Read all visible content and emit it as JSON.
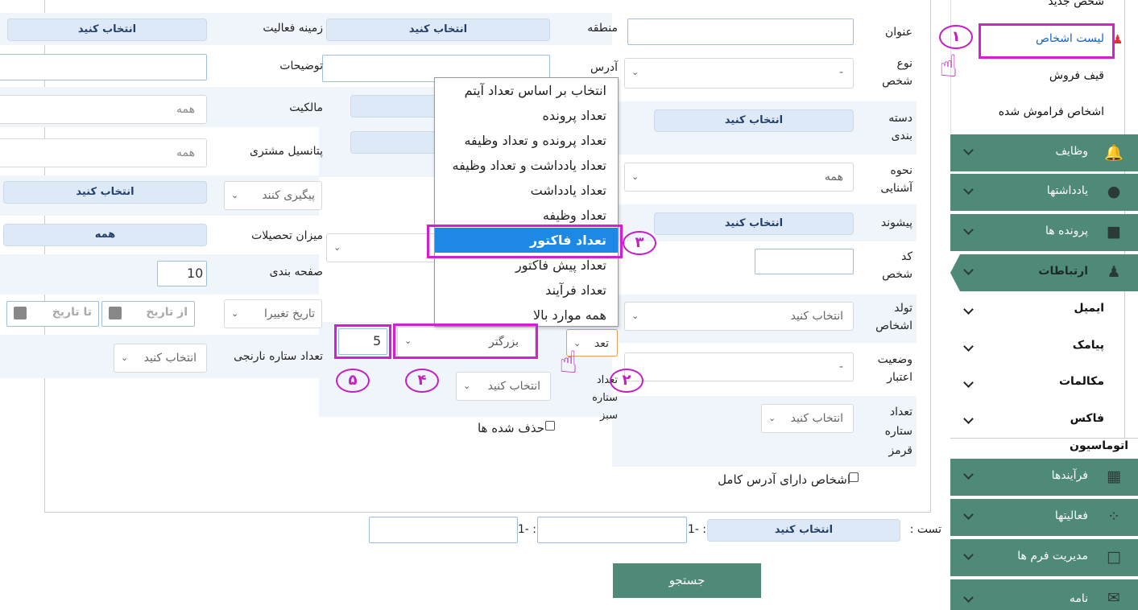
{
  "form": {
    "title_label": "عنوان",
    "person_type_label": "نوع شخص",
    "person_type_value": "-",
    "category_label": "دسته بندی",
    "category_value": "انتخاب کنید",
    "acquaintance_label": "نحوه آشنایی",
    "acquaintance_value": "همه",
    "prefix_label": "پیشوند",
    "prefix_value": "انتخاب کنید",
    "person_code_label": "کد شخص",
    "birth_label": "تولد اشخاص",
    "birth_value": "انتخاب کنید",
    "credit_status_label": "وضعیت اعتبار",
    "credit_status_value": "-",
    "red_stars_label": "تعداد ستاره قرمز",
    "red_stars_value": "انتخاب کنید",
    "full_address_label": "اشخاص دارای آدرس کامل",
    "region_label": "منطقه",
    "region_value": "انتخاب کنید",
    "address_label": "آدرس",
    "green_stars_label": "تعداد ستاره سبز",
    "green_stars_value": "انتخاب کنید",
    "count_select_value": "تعد",
    "comparison_value": "بزرگتر",
    "count_number": "5",
    "deleted_label": "حذف شده ها",
    "activity_field_label": "زمینه فعالیت",
    "activity_field_value": "انتخاب کنید",
    "description_label": "توضیحات",
    "ownership_label": "مالکیت",
    "ownership_value": "همه",
    "customer_potential_label": "پتانسیل مشتری",
    "customer_potential_value": "همه",
    "followup_value": "پیگیری کنند",
    "followup_pill": "انتخاب کنید",
    "education_label": "میزان تحصیلات",
    "education_value": "همه",
    "paging_label": "صفحه بندی",
    "paging_value": "10",
    "change_date_value": "تاریخ تغییرا",
    "from_date_placeholder": "از تاریخ",
    "to_date_placeholder": "تا تاریخ",
    "orange_stars_label": "تعداد ستاره نارنجی",
    "orange_stars_value": "انتخاب کنید",
    "test_label": "تست :",
    "test_value": "انتخاب کنید",
    "range_sep_1": "1- :",
    "range_sep_2": "1- :",
    "search_button": "جستجو"
  },
  "dropdown": {
    "items": [
      "انتخاب بر اساس تعداد آیتم",
      "تعداد پرونده",
      "تعداد پرونده و تعداد وظیفه",
      "تعداد یادداشت و تعداد وظیفه",
      "تعداد یادداشت",
      "تعداد وظیفه",
      "تعداد فاکتور",
      "تعداد پیش فاکتور",
      "تعداد فرآیند",
      "همه موارد بالا"
    ],
    "selected_index": 6
  },
  "sidebar": {
    "new_person": "شخص جدید",
    "person_list": "لیست اشخاص",
    "sales_funnel": "قیف فروش",
    "forgotten_persons": "اشخاص فراموش شده",
    "tasks": "وظایف",
    "notes": "یادداشتها",
    "files": "پرونده ها",
    "communications": "ارتباطات",
    "email": "ایمیل",
    "sms": "پیامک",
    "calls": "مکالمات",
    "fax": "فاکس",
    "automation": "اتوماسیون",
    "processes": "فرآیندها",
    "activities": "فعالیتها",
    "form_management": "مدیریت فرم ها",
    "letter": "نامه"
  },
  "annotations": {
    "step1": "۱",
    "step2": "۲",
    "step3": "۳",
    "step4": "۴",
    "step5": "۵"
  },
  "colors": {
    "sidebar_green": "#4f8a79",
    "highlight_magenta": "#d11fd1",
    "selected_blue": "#1e88e5",
    "pill_bg": "#dde9f6"
  }
}
